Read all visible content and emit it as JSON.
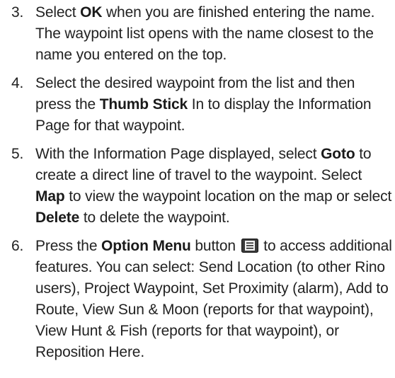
{
  "steps": [
    {
      "number": "3.",
      "p1": "Select ",
      "b1": "OK",
      "p2": " when you are finished entering the name. The waypoint list opens with the name closest to the name you entered on the top."
    },
    {
      "number": "4.",
      "p1": "Select the desired waypoint from the list and then press the ",
      "b1": "Thumb Stick",
      "p2": " In to display the Information Page for that waypoint."
    },
    {
      "number": "5.",
      "p1": "With the Information Page displayed, select ",
      "b1": "Goto",
      "p2": " to create a direct line of travel to the waypoint. Select ",
      "b2": "Map",
      "p3": " to view the waypoint location on the map or select ",
      "b3": "Delete",
      "p4": " to delete the waypoint."
    },
    {
      "number": "6.",
      "p1": "Press the ",
      "b1": "Option Menu",
      "p2": " button ",
      "icon": "option-menu-icon",
      "p3": " to access additional features. You can select: Send Location (to other Rino users), Project Waypoint, Set Proximity (alarm), Add to Route, View Sun & Moon (reports for that waypoint), View Hunt & Fish (reports for that waypoint), or Reposition Here."
    }
  ]
}
